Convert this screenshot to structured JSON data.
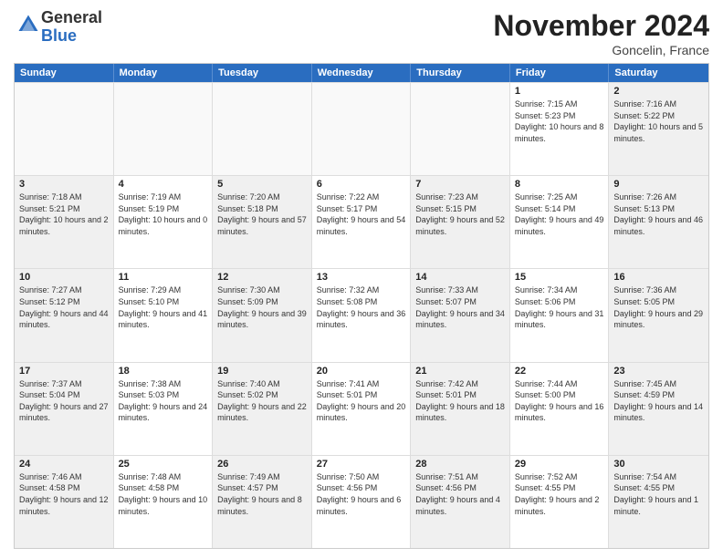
{
  "logo": {
    "general": "General",
    "blue": "Blue"
  },
  "title": "November 2024",
  "location": "Goncelin, France",
  "days_of_week": [
    "Sunday",
    "Monday",
    "Tuesday",
    "Wednesday",
    "Thursday",
    "Friday",
    "Saturday"
  ],
  "rows": [
    [
      {
        "day": "",
        "info": "",
        "empty": true
      },
      {
        "day": "",
        "info": "",
        "empty": true
      },
      {
        "day": "",
        "info": "",
        "empty": true
      },
      {
        "day": "",
        "info": "",
        "empty": true
      },
      {
        "day": "",
        "info": "",
        "empty": true
      },
      {
        "day": "1",
        "info": "Sunrise: 7:15 AM\nSunset: 5:23 PM\nDaylight: 10 hours and 8 minutes.",
        "empty": false
      },
      {
        "day": "2",
        "info": "Sunrise: 7:16 AM\nSunset: 5:22 PM\nDaylight: 10 hours and 5 minutes.",
        "empty": false
      }
    ],
    [
      {
        "day": "3",
        "info": "Sunrise: 7:18 AM\nSunset: 5:21 PM\nDaylight: 10 hours and 2 minutes.",
        "empty": false
      },
      {
        "day": "4",
        "info": "Sunrise: 7:19 AM\nSunset: 5:19 PM\nDaylight: 10 hours and 0 minutes.",
        "empty": false
      },
      {
        "day": "5",
        "info": "Sunrise: 7:20 AM\nSunset: 5:18 PM\nDaylight: 9 hours and 57 minutes.",
        "empty": false
      },
      {
        "day": "6",
        "info": "Sunrise: 7:22 AM\nSunset: 5:17 PM\nDaylight: 9 hours and 54 minutes.",
        "empty": false
      },
      {
        "day": "7",
        "info": "Sunrise: 7:23 AM\nSunset: 5:15 PM\nDaylight: 9 hours and 52 minutes.",
        "empty": false
      },
      {
        "day": "8",
        "info": "Sunrise: 7:25 AM\nSunset: 5:14 PM\nDaylight: 9 hours and 49 minutes.",
        "empty": false
      },
      {
        "day": "9",
        "info": "Sunrise: 7:26 AM\nSunset: 5:13 PM\nDaylight: 9 hours and 46 minutes.",
        "empty": false
      }
    ],
    [
      {
        "day": "10",
        "info": "Sunrise: 7:27 AM\nSunset: 5:12 PM\nDaylight: 9 hours and 44 minutes.",
        "empty": false
      },
      {
        "day": "11",
        "info": "Sunrise: 7:29 AM\nSunset: 5:10 PM\nDaylight: 9 hours and 41 minutes.",
        "empty": false
      },
      {
        "day": "12",
        "info": "Sunrise: 7:30 AM\nSunset: 5:09 PM\nDaylight: 9 hours and 39 minutes.",
        "empty": false
      },
      {
        "day": "13",
        "info": "Sunrise: 7:32 AM\nSunset: 5:08 PM\nDaylight: 9 hours and 36 minutes.",
        "empty": false
      },
      {
        "day": "14",
        "info": "Sunrise: 7:33 AM\nSunset: 5:07 PM\nDaylight: 9 hours and 34 minutes.",
        "empty": false
      },
      {
        "day": "15",
        "info": "Sunrise: 7:34 AM\nSunset: 5:06 PM\nDaylight: 9 hours and 31 minutes.",
        "empty": false
      },
      {
        "day": "16",
        "info": "Sunrise: 7:36 AM\nSunset: 5:05 PM\nDaylight: 9 hours and 29 minutes.",
        "empty": false
      }
    ],
    [
      {
        "day": "17",
        "info": "Sunrise: 7:37 AM\nSunset: 5:04 PM\nDaylight: 9 hours and 27 minutes.",
        "empty": false
      },
      {
        "day": "18",
        "info": "Sunrise: 7:38 AM\nSunset: 5:03 PM\nDaylight: 9 hours and 24 minutes.",
        "empty": false
      },
      {
        "day": "19",
        "info": "Sunrise: 7:40 AM\nSunset: 5:02 PM\nDaylight: 9 hours and 22 minutes.",
        "empty": false
      },
      {
        "day": "20",
        "info": "Sunrise: 7:41 AM\nSunset: 5:01 PM\nDaylight: 9 hours and 20 minutes.",
        "empty": false
      },
      {
        "day": "21",
        "info": "Sunrise: 7:42 AM\nSunset: 5:01 PM\nDaylight: 9 hours and 18 minutes.",
        "empty": false
      },
      {
        "day": "22",
        "info": "Sunrise: 7:44 AM\nSunset: 5:00 PM\nDaylight: 9 hours and 16 minutes.",
        "empty": false
      },
      {
        "day": "23",
        "info": "Sunrise: 7:45 AM\nSunset: 4:59 PM\nDaylight: 9 hours and 14 minutes.",
        "empty": false
      }
    ],
    [
      {
        "day": "24",
        "info": "Sunrise: 7:46 AM\nSunset: 4:58 PM\nDaylight: 9 hours and 12 minutes.",
        "empty": false
      },
      {
        "day": "25",
        "info": "Sunrise: 7:48 AM\nSunset: 4:58 PM\nDaylight: 9 hours and 10 minutes.",
        "empty": false
      },
      {
        "day": "26",
        "info": "Sunrise: 7:49 AM\nSunset: 4:57 PM\nDaylight: 9 hours and 8 minutes.",
        "empty": false
      },
      {
        "day": "27",
        "info": "Sunrise: 7:50 AM\nSunset: 4:56 PM\nDaylight: 9 hours and 6 minutes.",
        "empty": false
      },
      {
        "day": "28",
        "info": "Sunrise: 7:51 AM\nSunset: 4:56 PM\nDaylight: 9 hours and 4 minutes.",
        "empty": false
      },
      {
        "day": "29",
        "info": "Sunrise: 7:52 AM\nSunset: 4:55 PM\nDaylight: 9 hours and 2 minutes.",
        "empty": false
      },
      {
        "day": "30",
        "info": "Sunrise: 7:54 AM\nSunset: 4:55 PM\nDaylight: 9 hours and 1 minute.",
        "empty": false
      }
    ]
  ]
}
